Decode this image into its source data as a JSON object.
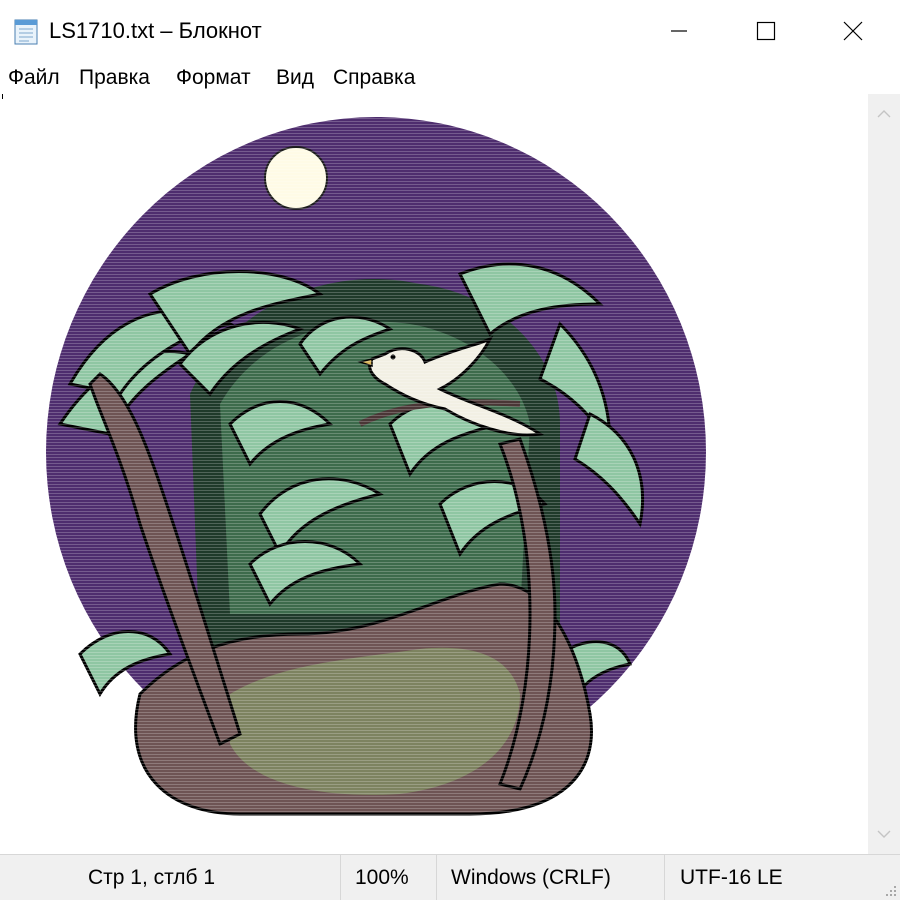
{
  "window": {
    "title": "LS1710.txt – Блокнот",
    "app_icon": "notepad-icon",
    "controls": [
      "minimize-icon",
      "maximize-icon",
      "close-icon"
    ]
  },
  "menu": {
    "items": [
      {
        "label": "Файл"
      },
      {
        "label": "Правка"
      },
      {
        "label": "Формат"
      },
      {
        "label": "Вид"
      },
      {
        "label": "Справка"
      }
    ]
  },
  "editor": {
    "content": "ASCII-art illustration: a white bird perched on a branch among jungle plants on a brown rock, against a purple night sky with a pale moon",
    "colors": {
      "sky": "#4e2d6e",
      "moon": "#fffbe6",
      "foliage_light": "#8fc6a3",
      "foliage_dark": "#1f3a2a",
      "rock": "#6e5454",
      "rock_light": "#7d8360",
      "bird": "#f2f0e4",
      "outline": "#000000"
    }
  },
  "scrollbar": {
    "icons": [
      "chevron-up-icon",
      "chevron-down-icon"
    ]
  },
  "status": {
    "position": "Стр 1, стлб 1",
    "zoom": "100%",
    "line_endings": "Windows (CRLF)",
    "encoding": "UTF-16 LE"
  }
}
